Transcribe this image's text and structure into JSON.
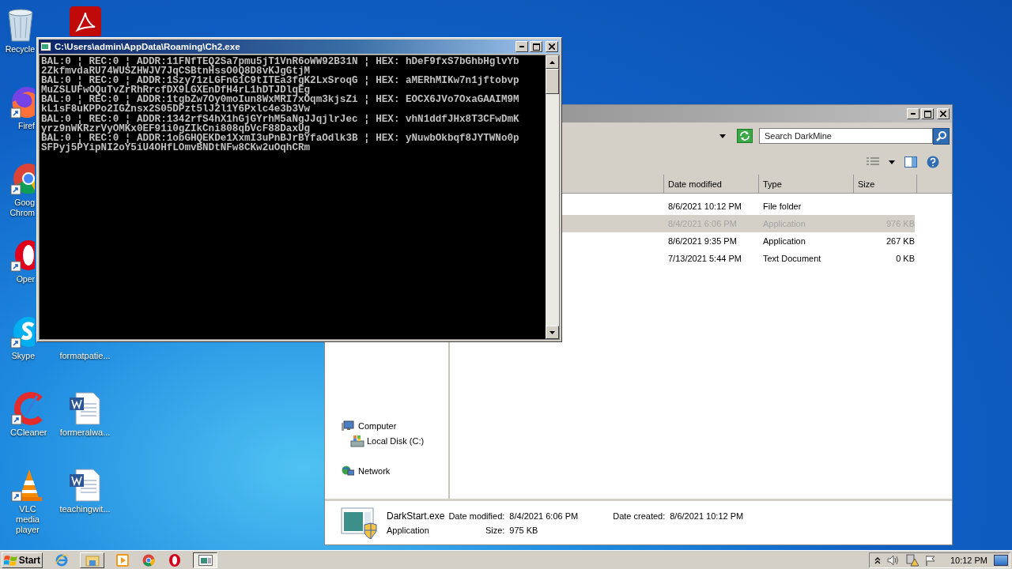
{
  "desktop": {
    "columns": [
      [
        {
          "label": "Recycle",
          "kind": "recycle"
        },
        {
          "label": "Firef",
          "kind": "firefox"
        },
        {
          "label": "Goog Chrom",
          "kind": "chrome"
        },
        {
          "label": "Oper",
          "kind": "opera"
        },
        {
          "label": "Skype",
          "kind": "skype"
        },
        {
          "label": "CCleaner",
          "kind": "ccleaner"
        },
        {
          "label": "VLC media player",
          "kind": "vlc"
        }
      ],
      [
        {
          "kind": "pdf"
        },
        {
          "label": "formatpatie...",
          "kind": "hidden"
        },
        {
          "label": "formeralwa...",
          "kind": "word"
        },
        {
          "label": "teachingwit...",
          "kind": "word"
        }
      ]
    ]
  },
  "console": {
    "title": "C:\\Users\\admin\\AppData\\Roaming\\Ch2.exe",
    "lines": [
      "BAL:0 ¦ REC:0 ¦ ADDR:11FNfTEQ2Sa7pmu5jT1VnR6oWW92B31N ¦ HEX: hDeF9fxS7bGhbHglvYb",
      "2ZkfmvdaRU74WUSZHWJV7JqCSBtnHssO0Q8D8vKJgGtjM",
      "BAL:0 ¦ REC:0 ¦ ADDR:1Szy71zLGFnG1C9tITEa3fgK2LxSroqG ¦ HEX: aMERhMIKw7n1jftobvp",
      "MuZSLUFwOQuTvZrRhRrcfDX9LGXEnDfH4rL1hDTJDlqEg",
      "BAL:0 ¦ REC:0 ¦ ADDR:1tgbZw7Oy0moIun8WxMRI7xOqm3kjsZi ¦ HEX: EOCX6JVo7OxaGAAIM9M",
      "kL1sF8uKPPo2IGZnsx2S05DPzt5lJ2l1Y6Pxlc4e3b3Vw",
      "BAL:0 ¦ REC:0 ¦ ADDR:1342rfS4hX1hGjGYrhM5aNgJJqjlrJec ¦ HEX: vhN1ddfJHx8T3CFwDmK",
      "yrz9nWKRzrVyOMKx0EF91i0gZIkCni808qbVcF88DaxUg",
      "BAL:0 ¦ REC:0 ¦ ADDR:1obGHQEKDe1XxmI3uPnBJrBYfaOdlk3B ¦ HEX: yNuwbOkbqf8JYTWNo0p",
      "SFPyj5PYipNI2oY5iU4OHfLOmvBNDtNFw8CKw2uOqhCRm"
    ]
  },
  "explorer": {
    "search": {
      "placeholder": "Search DarkMine"
    },
    "columns": [
      "Date modified",
      "Type",
      "Size"
    ],
    "rows": [
      {
        "date": "8/6/2021 10:12 PM",
        "type": "File folder",
        "selected": false
      },
      {
        "date": "8/4/2021 6:06 PM",
        "type": "Application",
        "size": "976 KB",
        "selected": true
      },
      {
        "date": "8/6/2021 9:35 PM",
        "type": "Application",
        "size": "267 KB",
        "selected": false
      },
      {
        "date": "7/13/2021 5:44 PM",
        "type": "Text Document",
        "size": "0 KB",
        "selected": false
      }
    ],
    "nav": [
      {
        "label": "Computer",
        "kind": "computer",
        "children": [
          {
            "label": "Local Disk (C:)",
            "kind": "disk"
          }
        ]
      },
      {
        "label": "Network",
        "kind": "network"
      }
    ],
    "details": {
      "name": "DarkStart.exe",
      "type": "Application",
      "fields": [
        {
          "label": "Date modified:",
          "value": "8/4/2021 6:06 PM"
        },
        {
          "label": "Size:",
          "value": "975 KB"
        },
        {
          "label": "Date created:",
          "value": "8/6/2021 10:12 PM"
        }
      ]
    }
  },
  "taskbar": {
    "start": "Start",
    "items": [
      {
        "kind": "ie",
        "open": false,
        "selected": false
      },
      {
        "kind": "explorer",
        "open": true,
        "selected": false
      },
      {
        "kind": "media",
        "open": false,
        "selected": false
      },
      {
        "kind": "chrome",
        "open": false,
        "selected": false
      },
      {
        "kind": "opera",
        "open": false,
        "selected": false
      },
      {
        "kind": "console",
        "open": true,
        "selected": true
      }
    ],
    "clock": "10:12 PM"
  }
}
